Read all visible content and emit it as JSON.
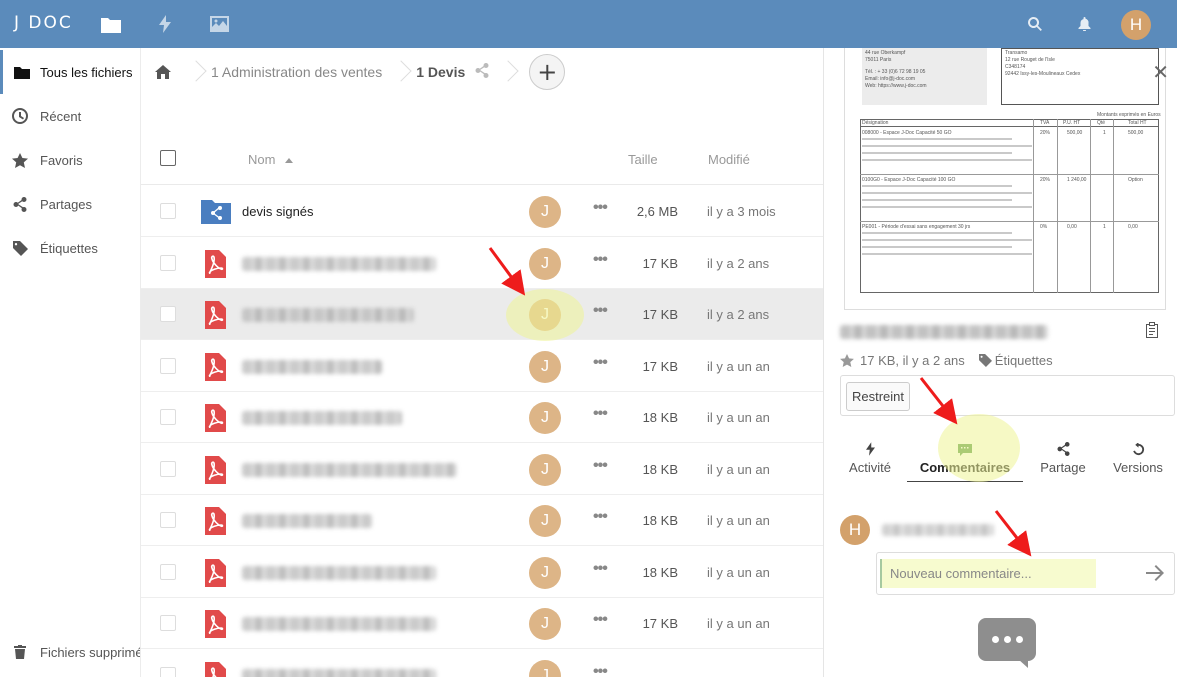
{
  "header": {
    "logo": "J DOC",
    "apps": [
      "files-icon",
      "activity-icon",
      "gallery-icon"
    ],
    "user_initial": "H"
  },
  "sidebar": {
    "items": [
      {
        "label": "Tous les fichiers",
        "icon": "folder-icon",
        "active": true
      },
      {
        "label": "Récent",
        "icon": "clock-icon"
      },
      {
        "label": "Favoris",
        "icon": "star-icon"
      },
      {
        "label": "Partages",
        "icon": "share-icon"
      },
      {
        "label": "Étiquettes",
        "icon": "tag-icon"
      }
    ],
    "trash_label": "Fichiers supprimés"
  },
  "breadcrumb": {
    "items": [
      "1 Administration des ventes",
      "1 Devis"
    ],
    "add_label": "+"
  },
  "file_list": {
    "columns": {
      "name": "Nom",
      "size": "Taille",
      "modified": "Modifié"
    },
    "rows": [
      {
        "name": "devis signés",
        "type": "shared-folder",
        "owner": "J",
        "size": "2,6 MB",
        "modified": "il y a 3 mois"
      },
      {
        "name": "",
        "type": "pdf",
        "owner": "J",
        "size": "17 KB",
        "modified": "il y a 2 ans"
      },
      {
        "name": "",
        "type": "pdf",
        "owner": "J",
        "size": "17 KB",
        "modified": "il y a 2 ans",
        "selected": true
      },
      {
        "name": "",
        "type": "pdf",
        "owner": "J",
        "size": "17 KB",
        "modified": "il y a un an"
      },
      {
        "name": "",
        "type": "pdf",
        "owner": "J",
        "size": "18 KB",
        "modified": "il y a un an"
      },
      {
        "name": "",
        "type": "pdf",
        "owner": "J",
        "size": "18 KB",
        "modified": "il y a un an"
      },
      {
        "name": "",
        "type": "pdf",
        "owner": "J",
        "size": "18 KB",
        "modified": "il y a un an"
      },
      {
        "name": "",
        "type": "pdf",
        "owner": "J",
        "size": "18 KB",
        "modified": "il y a un an"
      },
      {
        "name": "",
        "type": "pdf",
        "owner": "J",
        "size": "17 KB",
        "modified": "il y a un an"
      },
      {
        "name": "",
        "type": "pdf",
        "owner": "J",
        "size": "",
        "modified": ""
      }
    ],
    "more_label": "•••"
  },
  "details": {
    "meta": "17 KB, il y a 2 ans",
    "tags_label": "Étiquettes",
    "restricted_label": "Restreint",
    "tabs": [
      {
        "label": "Activité",
        "icon": "activity-icon"
      },
      {
        "label": "Commentaires",
        "icon": "comment-icon",
        "active": true
      },
      {
        "label": "Partage",
        "icon": "share-icon"
      },
      {
        "label": "Versions",
        "icon": "history-icon"
      }
    ],
    "comment_author_initial": "H",
    "comment_placeholder": "Nouveau commentaire...",
    "preview": {
      "left_block": [
        "44 rue Oberkampf",
        "75011 Paris",
        "Tél. : + 33 (0)6 72 98 19 05",
        "Email: info@j-doc.com",
        "Web: https://www.j-doc.com"
      ],
      "right_block": [
        "Transamo",
        "12 rue Rouget de l'Isle",
        "C348174",
        "92442 Issy-les-Moulineaux Cedex"
      ],
      "amounts_note": "Montants exprimés en Euros",
      "table_headers": [
        "Désignation",
        "TVA",
        "P.U. HT",
        "Qté",
        "Total HT"
      ],
      "table_rows": [
        {
          "desc": "008000 - Espace J-Doc Capacité 50 GO",
          "tva": "20%",
          "pu": "500,00",
          "qte": "1",
          "total": "500,00"
        },
        {
          "desc": "0100G0 - Espace J-Doc Capacité 100 GO",
          "tva": "20%",
          "pu": "1 240,00",
          "qte": "",
          "total": "Option"
        },
        {
          "desc": "PE001 - Période d'essai sans engagement 30 jrs",
          "tva": "0%",
          "pu": "0,00",
          "qte": "1",
          "total": "0,00"
        }
      ]
    }
  }
}
